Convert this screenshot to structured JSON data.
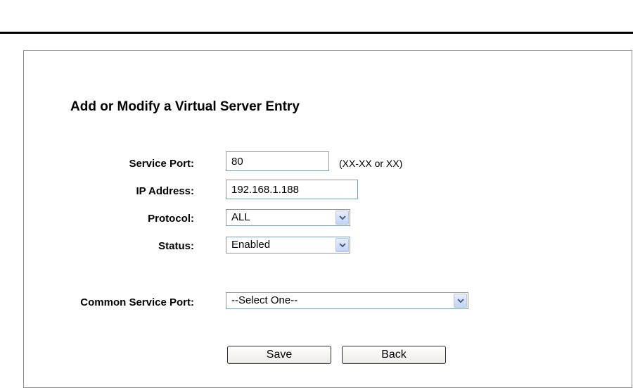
{
  "form": {
    "title": "Add or Modify a Virtual Server Entry",
    "service_port": {
      "label": "Service Port:",
      "value": "80",
      "hint": "(XX-XX or XX)"
    },
    "ip_address": {
      "label": "IP Address:",
      "value": "192.168.1.188"
    },
    "protocol": {
      "label": "Protocol:",
      "selected": "ALL"
    },
    "status": {
      "label": "Status:",
      "selected": "Enabled"
    },
    "common_service_port": {
      "label": "Common Service Port:",
      "selected": "--Select One--"
    }
  },
  "buttons": {
    "save_label": "Save",
    "back_label": "Back"
  },
  "icons": {
    "dropdown": "chevron-down-icon"
  },
  "colors": {
    "field_border": "#7f9db9",
    "dropdown_arrow_bg": "#c1d3fb"
  }
}
